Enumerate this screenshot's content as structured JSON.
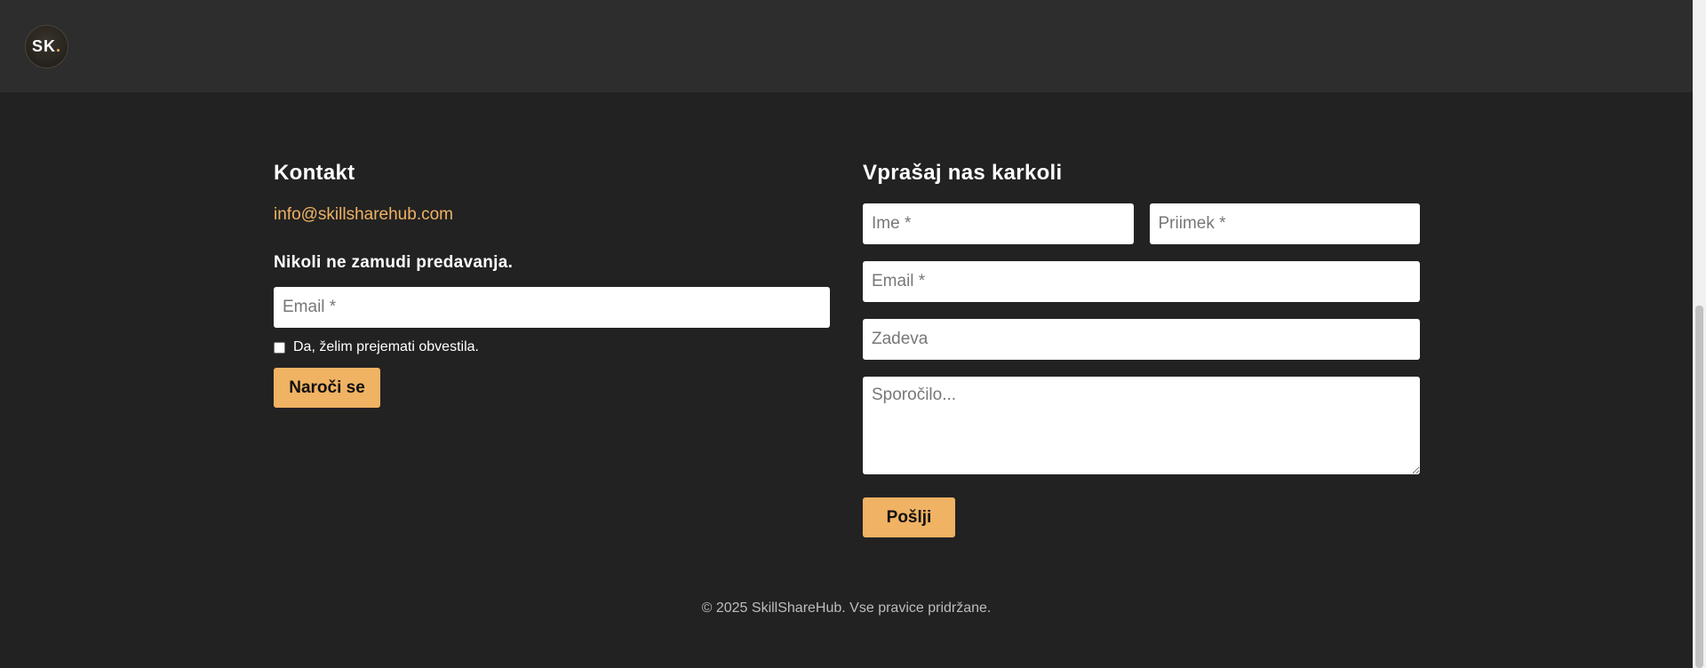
{
  "header": {
    "logo_text": "SK",
    "logo_dot": "."
  },
  "contact": {
    "title": "Kontakt",
    "email": "info@skillsharehub.com",
    "newsletter_heading": "Nikoli ne zamudi predavanja.",
    "newsletter_email_placeholder": "Email *",
    "checkbox_label": "Da, želim prejemati obvestila.",
    "subscribe_label": "Naroči se"
  },
  "form": {
    "title": "Vprašaj nas karkoli",
    "first_name_placeholder": "Ime *",
    "last_name_placeholder": "Priimek *",
    "email_placeholder": "Email *",
    "subject_placeholder": "Zadeva",
    "message_placeholder": "Sporočilo...",
    "send_label": "Pošlji"
  },
  "footer": {
    "copyright": "© 2025 SkillShareHub. Vse pravice pridržane."
  },
  "colors": {
    "accent": "#f0b263",
    "background": "#222222",
    "header": "#2d2d2d"
  }
}
